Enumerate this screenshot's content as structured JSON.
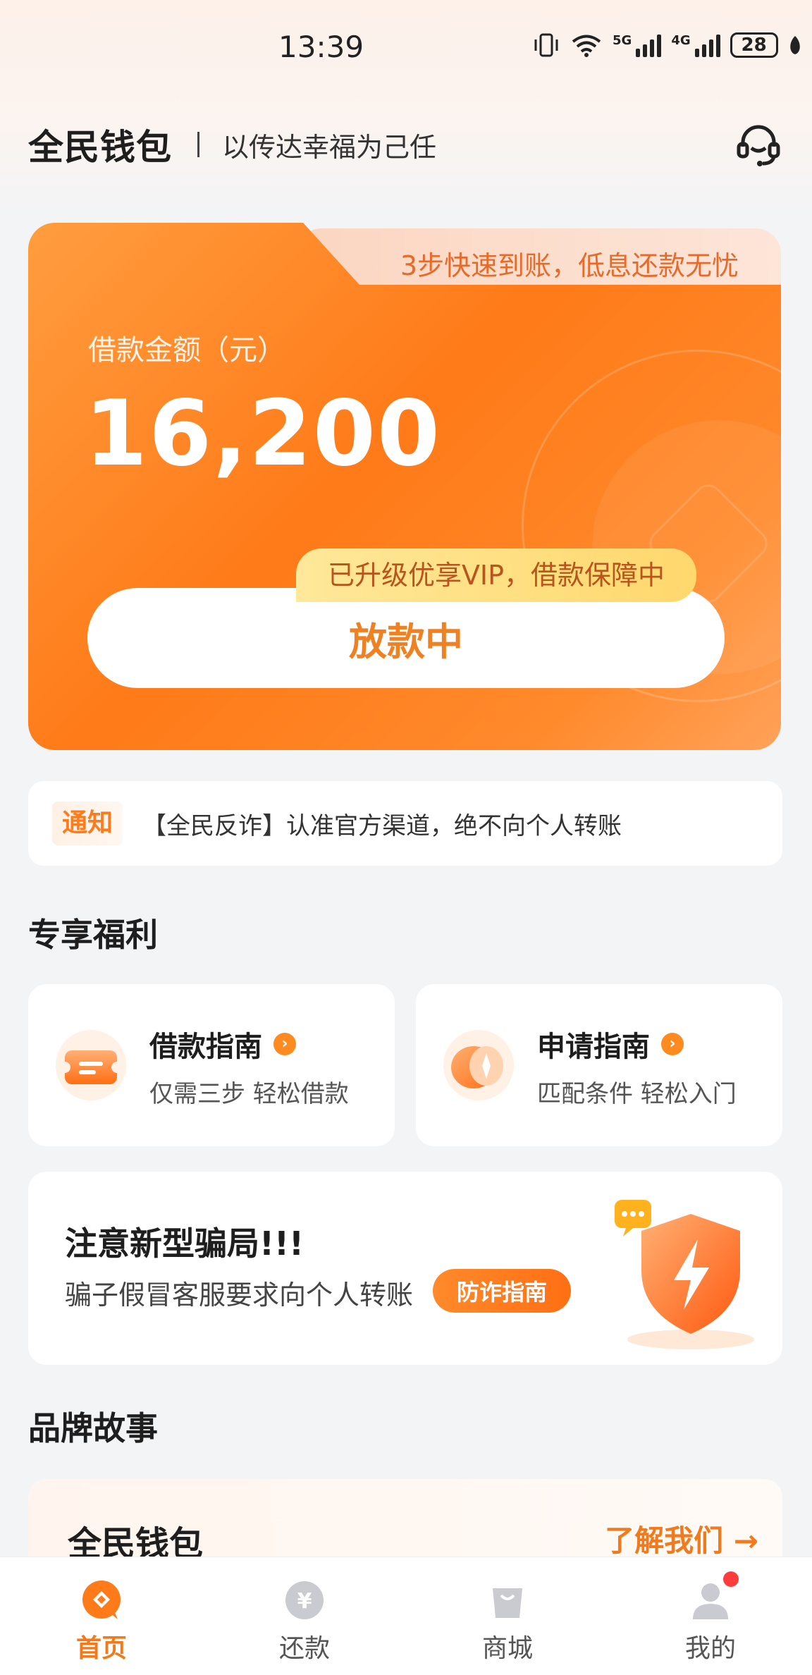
{
  "status_bar": {
    "time": "13:39",
    "signal1_label": "5G",
    "signal2_label": "4G",
    "battery": "28"
  },
  "header": {
    "brand": "全民钱包",
    "slogan": "以传达幸福为己任"
  },
  "hero": {
    "tab_text": "3步快速到账，低息还款无忧",
    "amount_label": "借款金额（元）",
    "amount": "16,200",
    "vip_badge": "已升级优享VIP，借款保障中",
    "status_button": "放款中"
  },
  "notice": {
    "tag": "通知",
    "text": "【全民反诈】认准官方渠道，绝不向个人转账"
  },
  "benefits": {
    "title": "专享福利",
    "items": [
      {
        "title": "借款指南",
        "subtitle": "仅需三步 轻松借款",
        "icon": "ticket-icon"
      },
      {
        "title": "申请指南",
        "subtitle": "匹配条件 轻松入门",
        "icon": "compass-icon"
      }
    ]
  },
  "fraud": {
    "title": "注意新型骗局!!!",
    "text": "骗子假冒客服要求向个人转账",
    "button": "防诈指南"
  },
  "story": {
    "section_title": "品牌故事",
    "title": "全民钱包",
    "link": "了解我们 →"
  },
  "nav": {
    "items": [
      {
        "label": "首页",
        "icon": "home-icon",
        "active": true
      },
      {
        "label": "还款",
        "icon": "repay-icon"
      },
      {
        "label": "商城",
        "icon": "shop-icon"
      },
      {
        "label": "我的",
        "icon": "profile-icon"
      }
    ]
  },
  "colors": {
    "accent": "#ff7a18",
    "accent_text": "#f07a1c",
    "badge_yellow": "#ffd86d",
    "dot_red": "#ff3b3b"
  }
}
